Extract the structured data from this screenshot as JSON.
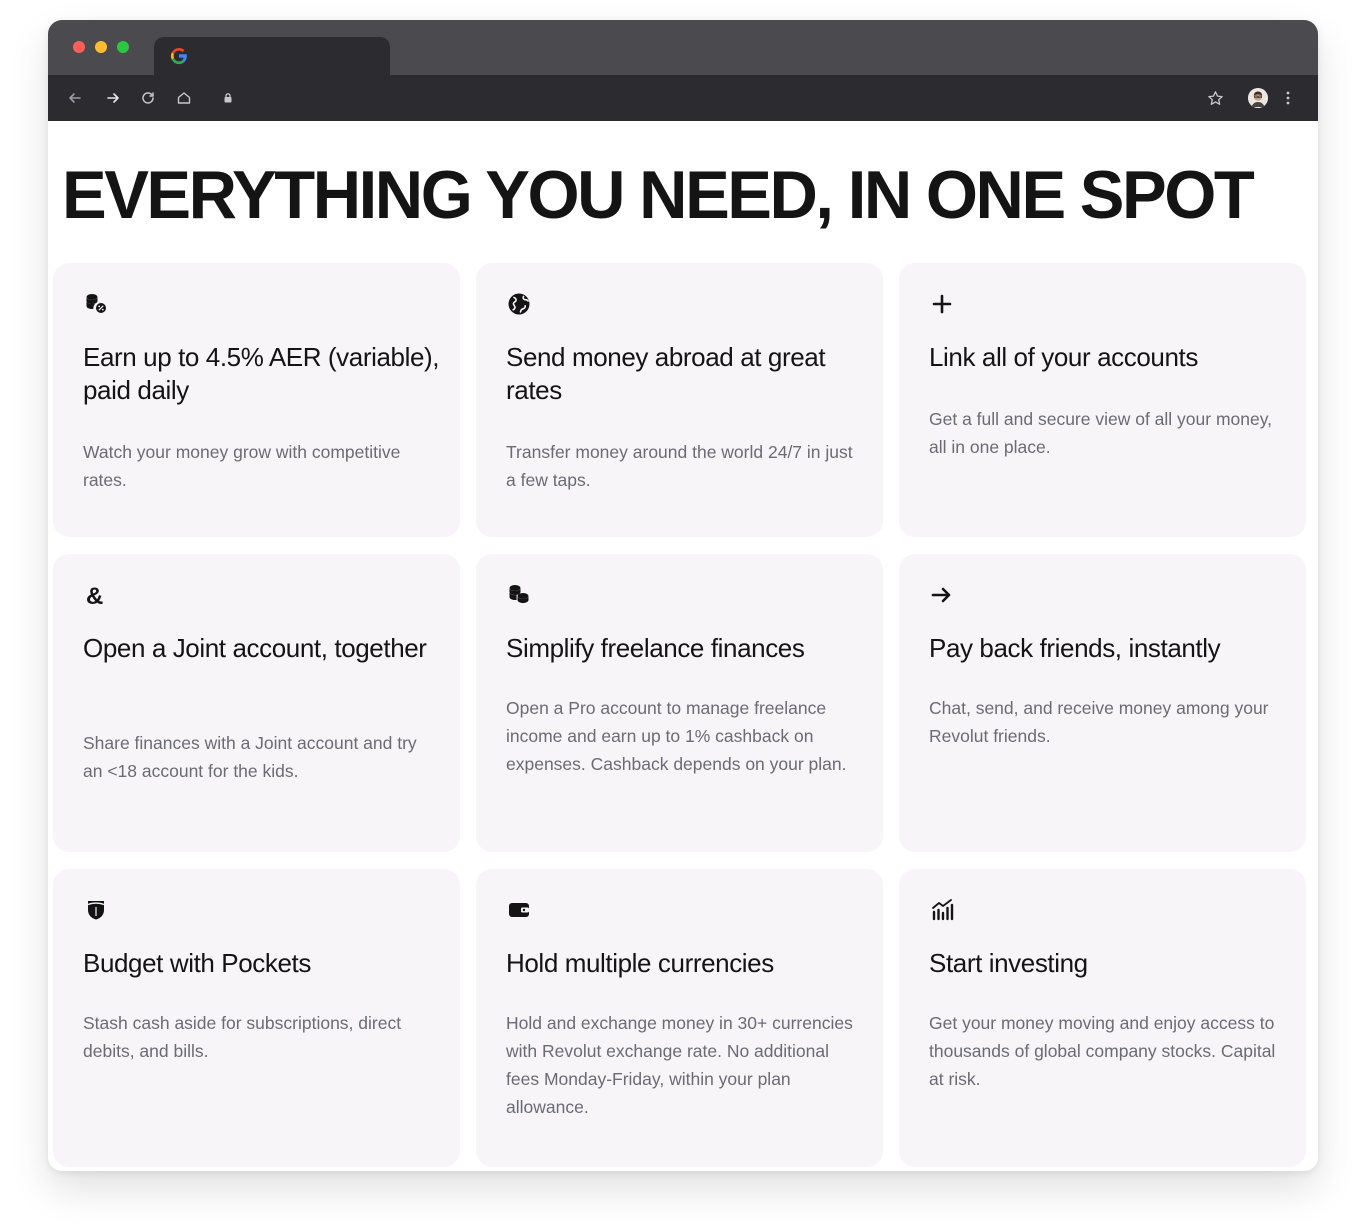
{
  "browser": {
    "tab_favicon": "G",
    "icons": [
      "back-icon",
      "forward-icon",
      "reload-icon",
      "home-icon",
      "lock-icon",
      "star-icon",
      "avatar",
      "menu-icon"
    ]
  },
  "page": {
    "title": "EVERYTHING YOU NEED, IN ONE SPOT"
  },
  "cards": [
    {
      "icon": "coins-percent-icon",
      "title": "Earn up to 4.5% AER (variable), paid daily",
      "text": "Watch your money grow with competitive rates."
    },
    {
      "icon": "globe-icon",
      "title": "Send money abroad at great rates",
      "text": "Transfer money around the world 24/7 in just a few taps."
    },
    {
      "icon": "plus-icon",
      "title": "Link all of your accounts",
      "text": "Get a full and secure view of all your money, all in one place."
    },
    {
      "icon": "ampersand-icon",
      "title": "Open a Joint account, together",
      "text": "Share finances with a Joint account and try an <18 account for the kids."
    },
    {
      "icon": "coins-icon",
      "title": "Simplify freelance finances",
      "text": "Open a Pro account to manage freelance income and earn up to 1% cashback on expenses. Cashback depends on your plan."
    },
    {
      "icon": "arrow-right-icon",
      "title": "Pay back friends, instantly",
      "text": "Chat, send, and receive money among your Revolut friends."
    },
    {
      "icon": "pocket-icon",
      "title": "Budget with Pockets",
      "text": "Stash cash aside for subscriptions, direct debits, and bills."
    },
    {
      "icon": "wallet-icon",
      "title": "Hold multiple currencies",
      "text": "Hold and exchange money in 30+ currencies with Revolut exchange rate. No additional fees Monday-Friday, within your plan allowance."
    },
    {
      "icon": "chart-icon",
      "title": "Start investing",
      "text": "Get your money moving and enjoy access to thousands of global company stocks. Capital at risk."
    }
  ]
}
